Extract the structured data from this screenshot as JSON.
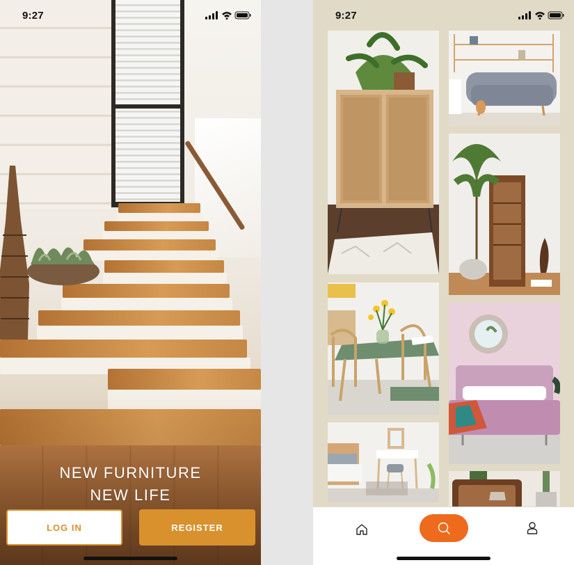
{
  "status_bar": {
    "welcome_time": "9:27",
    "feed_time": "9:27"
  },
  "welcome": {
    "tagline_line1": "NEW FURNITURE",
    "tagline_line2": "NEW LIFE",
    "login_label": "LOG IN",
    "register_label": "REGISTER"
  },
  "feed": {
    "tiles": [
      "rattan-cabinet-photo",
      "grey-sofa-photo",
      "wood-display-cabinet-photo",
      "green-dining-table-photo",
      "pink-bed-photo",
      "vanity-table-photo",
      "wood-sideboard-photo"
    ],
    "nav_icons": [
      "home-icon",
      "search-icon",
      "profile-icon"
    ]
  },
  "colors": {
    "accent_orange": "#d9912e",
    "search_orange": "#ee6a1d",
    "feed_background": "#e1dac6"
  }
}
